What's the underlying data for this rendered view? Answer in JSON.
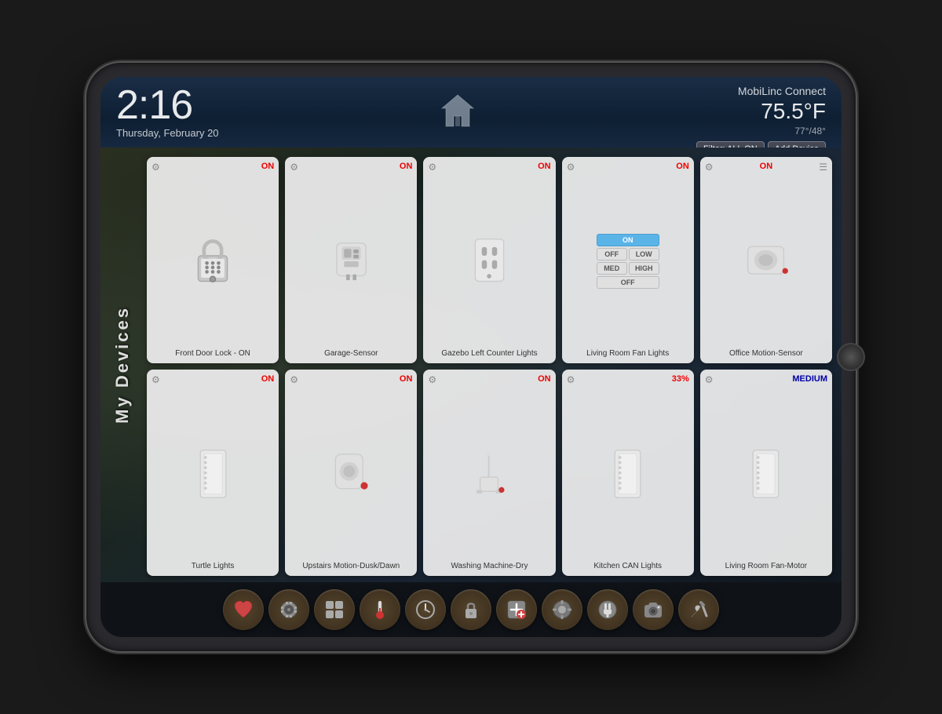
{
  "app": {
    "name": "MobiLinc Connect",
    "time": "2:16",
    "date": "Thursday, February 20",
    "temperature": "75.5°F",
    "temp_range": "77°/48°",
    "filter_label": "Filter: ALL ON",
    "add_device_label": "Add Device"
  },
  "sidebar": {
    "title": "My Devices"
  },
  "devices": [
    {
      "id": "front-door-lock",
      "name": "Front Door Lock - ON",
      "status": "ON",
      "type": "lock"
    },
    {
      "id": "garage-sensor",
      "name": "Garage-Sensor",
      "status": "ON",
      "type": "sensor"
    },
    {
      "id": "gazebo-lights",
      "name": "Gazebo Left Counter Lights",
      "status": "ON",
      "type": "outlet"
    },
    {
      "id": "living-room-fan",
      "name": "Living Room Fan Lights",
      "status": "ON",
      "type": "fan-control"
    },
    {
      "id": "office-motion",
      "name": "Office Motion-Sensor",
      "status": "ON",
      "type": "motion"
    },
    {
      "id": "turtle-lights",
      "name": "Turtle Lights",
      "status": "ON",
      "type": "switch"
    },
    {
      "id": "upstairs-motion",
      "name": "Upstairs Motion-Dusk/Dawn",
      "status": "ON",
      "type": "motion2"
    },
    {
      "id": "washing-machine",
      "name": "Washing Machine-Dry",
      "status": "ON",
      "type": "washer"
    },
    {
      "id": "kitchen-can",
      "name": "Kitchen CAN Lights",
      "status": "33%",
      "type": "switch2"
    },
    {
      "id": "living-room-fan-motor",
      "name": "Living Room Fan-Motor",
      "status": "MEDIUM",
      "type": "switch3"
    }
  ],
  "toolbar": {
    "items": [
      {
        "id": "favorites",
        "icon": "♥",
        "label": "Favorites"
      },
      {
        "id": "scenes",
        "icon": "🎬",
        "label": "Scenes"
      },
      {
        "id": "all-devices",
        "icon": "⊞",
        "label": "All Devices"
      },
      {
        "id": "thermostat",
        "icon": "🌡",
        "label": "Thermostat"
      },
      {
        "id": "clock",
        "icon": "⏰",
        "label": "Clock"
      },
      {
        "id": "lock",
        "icon": "🔒",
        "label": "Lock"
      },
      {
        "id": "add",
        "icon": "➕",
        "label": "Add"
      },
      {
        "id": "settings",
        "icon": "⚙",
        "label": "Settings"
      },
      {
        "id": "plug",
        "icon": "🔌",
        "label": "Plug"
      },
      {
        "id": "camera",
        "icon": "📷",
        "label": "Camera"
      },
      {
        "id": "tools",
        "icon": "🔧",
        "label": "Tools"
      }
    ]
  }
}
